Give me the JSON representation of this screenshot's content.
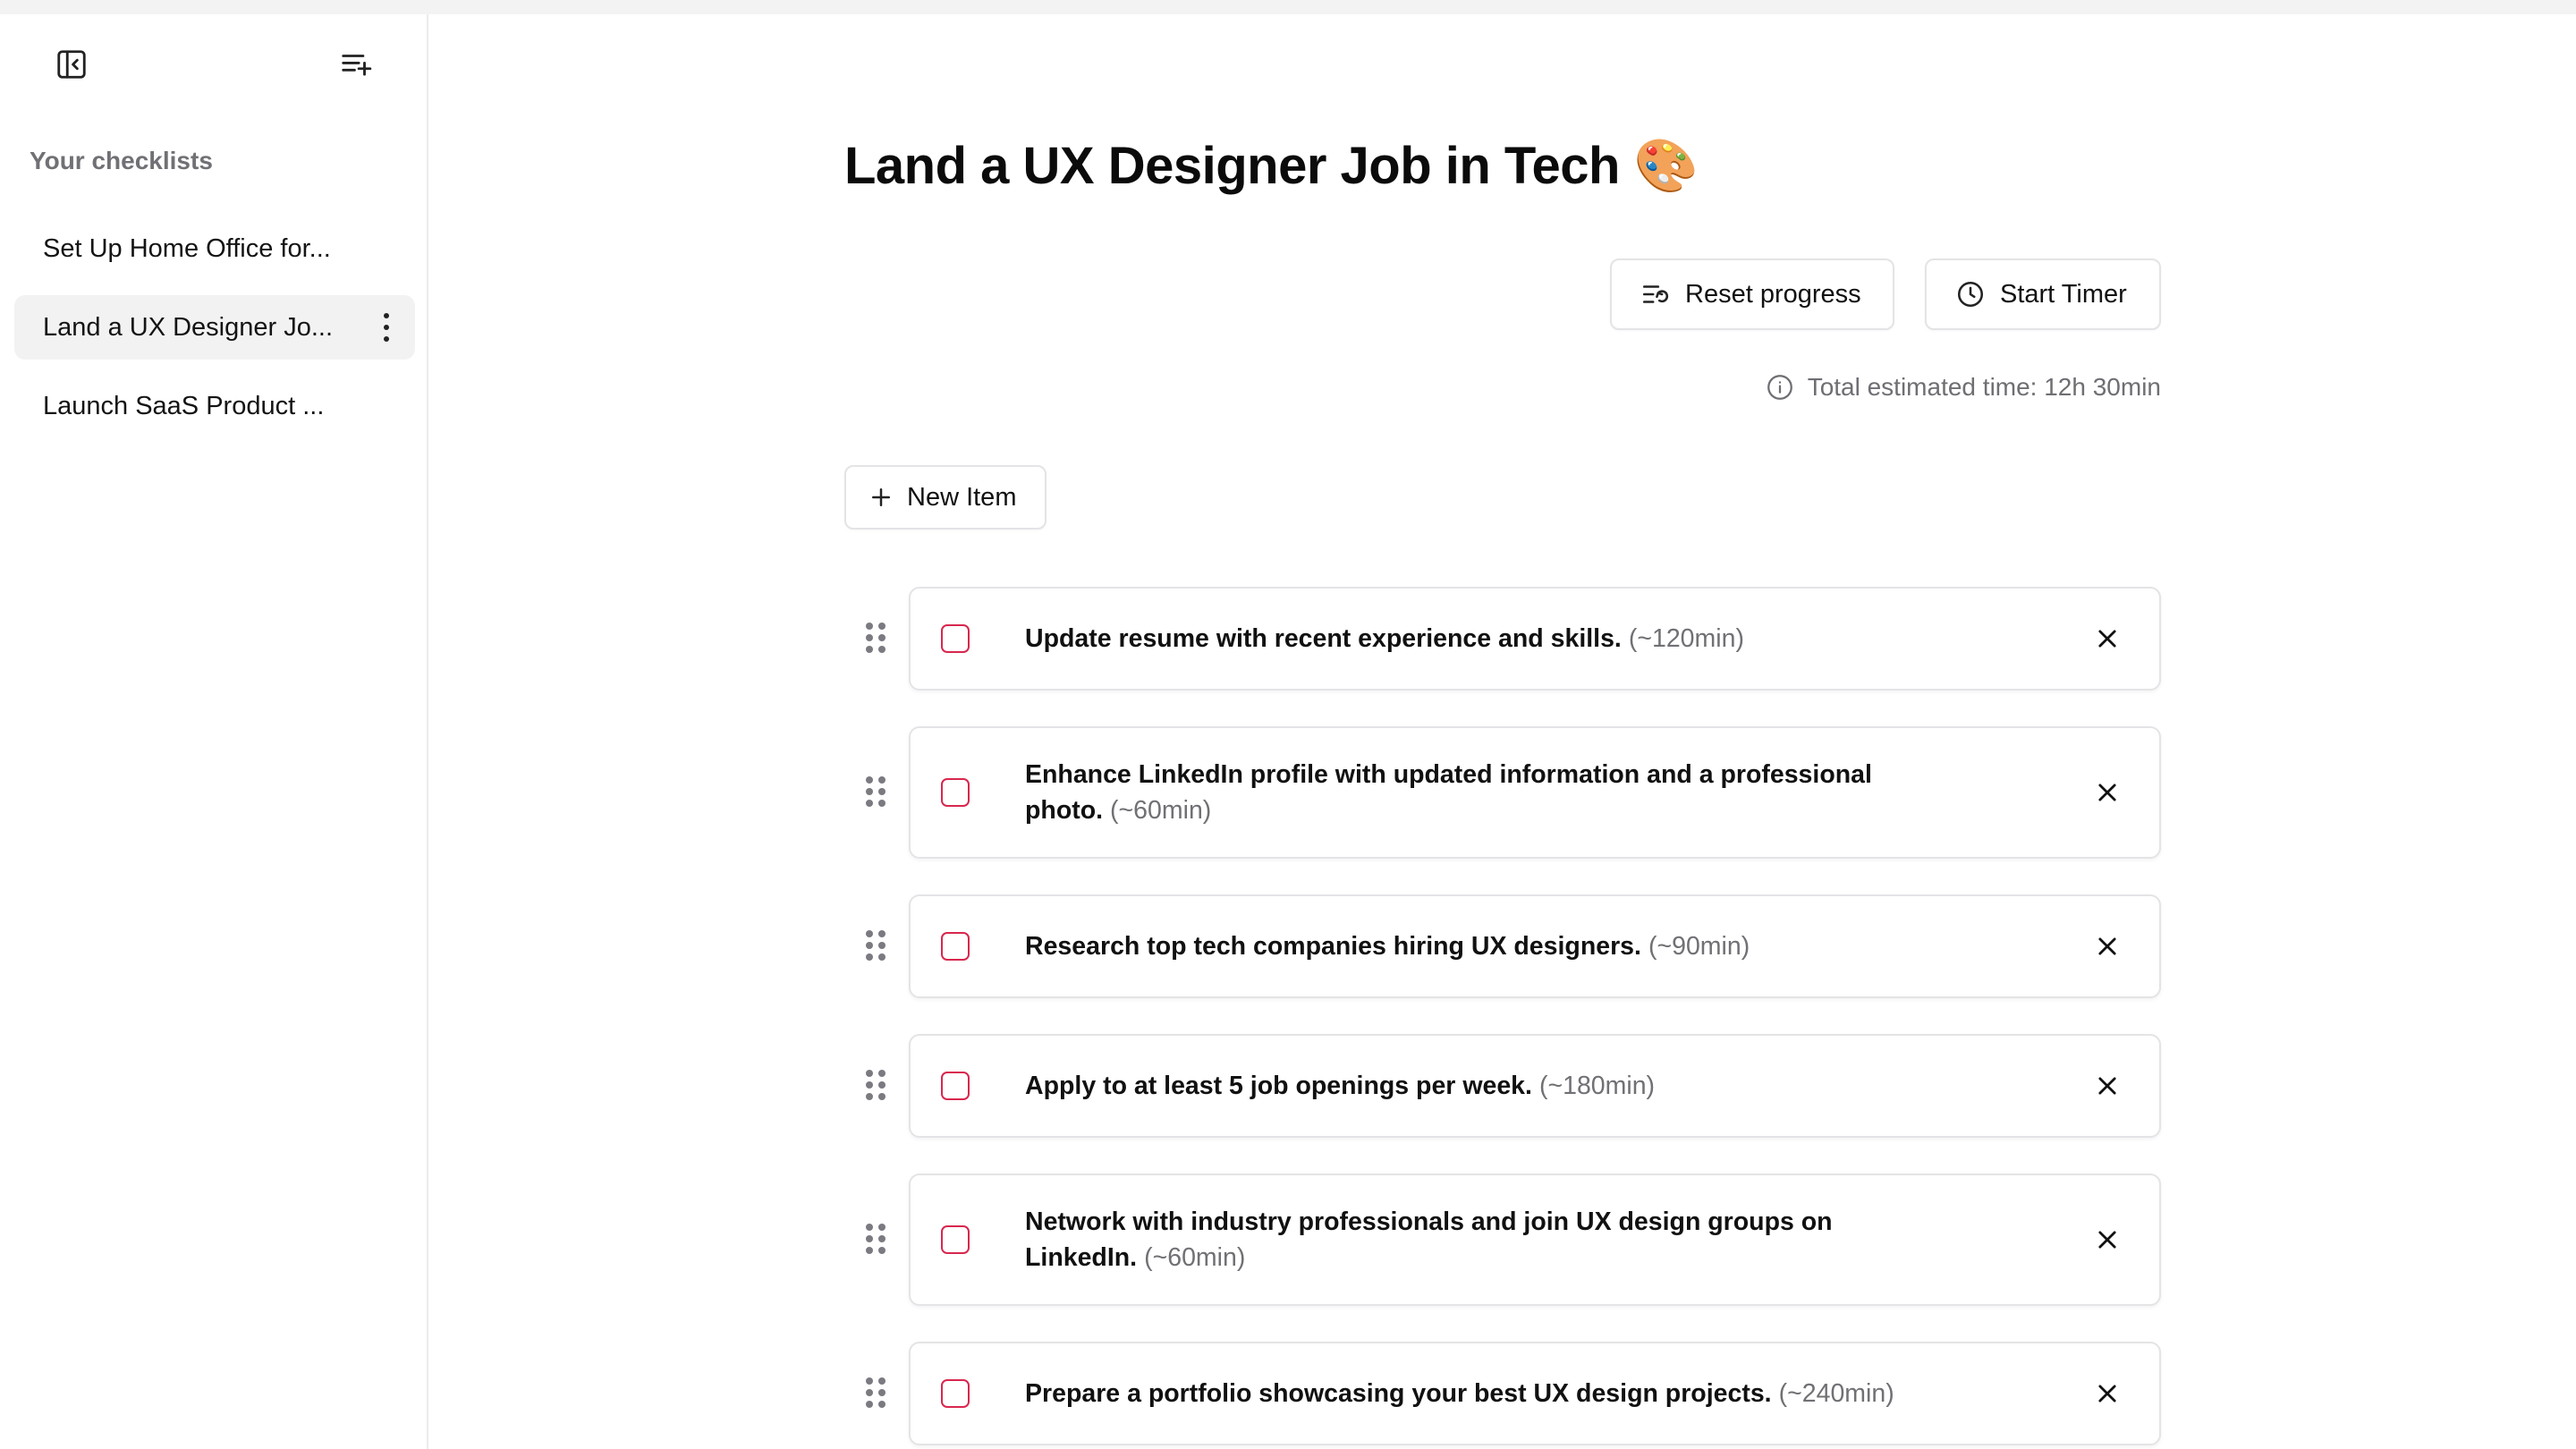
{
  "sidebar": {
    "heading": "Your checklists",
    "items": [
      {
        "label": "Set Up Home Office for...",
        "active": false
      },
      {
        "label": "Land a UX Designer Jo...",
        "active": true
      },
      {
        "label": "Launch SaaS Product ...",
        "active": false
      }
    ]
  },
  "main": {
    "title": "Land a UX Designer Job in Tech 🎨",
    "reset_label": "Reset progress",
    "timer_label": "Start Timer",
    "estimate": "Total estimated time: 12h 30min",
    "new_item_label": "New Item",
    "items": [
      {
        "text": "Update resume with recent experience and skills.",
        "time": "(~120min)",
        "checked": false
      },
      {
        "text": "Enhance LinkedIn profile with updated information and a professional photo.",
        "time": "(~60min)",
        "checked": false
      },
      {
        "text": "Research top tech companies hiring UX designers.",
        "time": "(~90min)",
        "checked": false
      },
      {
        "text": "Apply to at least 5 job openings per week.",
        "time": "(~180min)",
        "checked": false
      },
      {
        "text": "Network with industry professionals and join UX design groups on LinkedIn.",
        "time": "(~60min)",
        "checked": false
      },
      {
        "text": "Prepare a portfolio showcasing your best UX design projects.",
        "time": "(~240min)",
        "checked": false
      }
    ]
  },
  "colors": {
    "checkbox_border": "#d8274e",
    "muted_text": "#707075",
    "border": "#e4e4e7",
    "active_item_bg": "#f2f2f3"
  },
  "icons": {
    "collapse_sidebar": "panel-left-close-icon",
    "new_checklist": "list-plus-icon",
    "more": "more-vertical-icon",
    "reset": "list-restart-icon",
    "timer": "clock-icon",
    "info": "info-icon",
    "add": "plus-icon",
    "drag": "grip-vertical-icon",
    "delete": "close-icon"
  }
}
